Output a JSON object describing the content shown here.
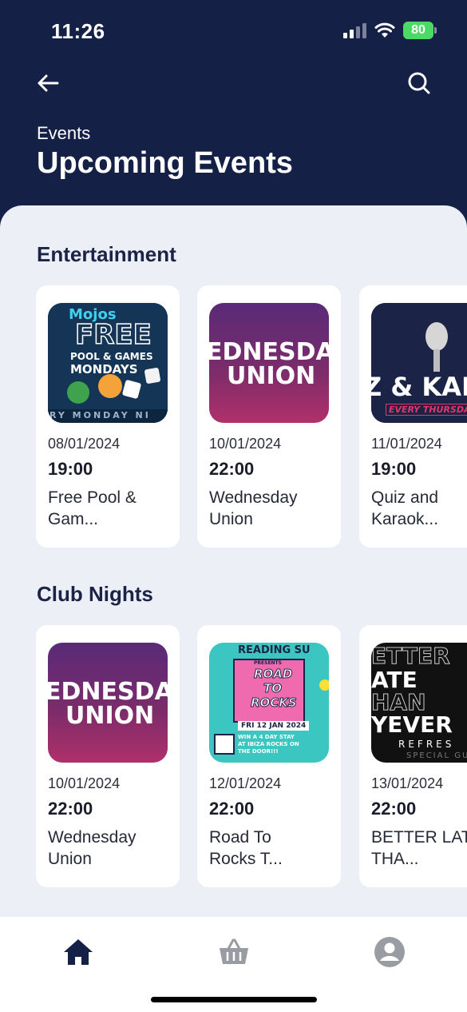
{
  "status_bar": {
    "time": "11:26",
    "battery": "80"
  },
  "header": {
    "breadcrumb": "Events",
    "title": "Upcoming Events"
  },
  "sections": [
    {
      "title": "Entertainment",
      "cards": [
        {
          "date": "08/01/2024",
          "time": "19:00",
          "name": "Free Pool &\nGam...",
          "thumb": {
            "logo": "Mojos",
            "line1": "FREE",
            "line2": "POOL & GAMES",
            "line3": "MONDAYS",
            "strip": "RY MONDAY NI"
          }
        },
        {
          "date": "10/01/2024",
          "time": "22:00",
          "name": "Wednesday\nUnion",
          "thumb": {
            "line1": "EDNESDA",
            "line2": "UNION"
          }
        },
        {
          "date": "11/01/2024",
          "time": "19:00",
          "name": "Quiz and\nKaraok...",
          "thumb": {
            "line1": "Z & KAR",
            "line2": "EVERY THURSDAY"
          }
        }
      ]
    },
    {
      "title": "Club Nights",
      "cards": [
        {
          "date": "10/01/2024",
          "time": "22:00",
          "name": "Wednesday\nUnion",
          "thumb": {
            "line1": "EDNESDA",
            "line2": "UNION"
          }
        },
        {
          "date": "12/01/2024",
          "time": "22:00",
          "name": "Road To\nRocks T...",
          "thumb": {
            "top": "READING SU",
            "presents": "PRESENTS",
            "title1": "ROAD",
            "title2": "TO",
            "title3": "ROCKS",
            "date": "FRI 12 JAN 2024",
            "promo": "WIN A 4 DAY STAY AT IBIZA ROCKS ON THE DOOR!!!"
          }
        },
        {
          "date": "13/01/2024",
          "time": "22:00",
          "name": "BETTER LAT\nTHA...",
          "thumb": {
            "l1": "ETTER",
            "l2": "ATE",
            "l3": "HAN",
            "l4": "YEVER",
            "l5": "REFRES",
            "l6": "SPECIAL GU"
          }
        }
      ]
    }
  ],
  "tabs": [
    "home-icon",
    "basket-icon",
    "profile-icon"
  ],
  "colors": {
    "navy": "#152047",
    "background": "#eceff5",
    "battery": "#4cd964",
    "active_tab": "#152047",
    "inactive_tab": "#9a9ca3"
  }
}
